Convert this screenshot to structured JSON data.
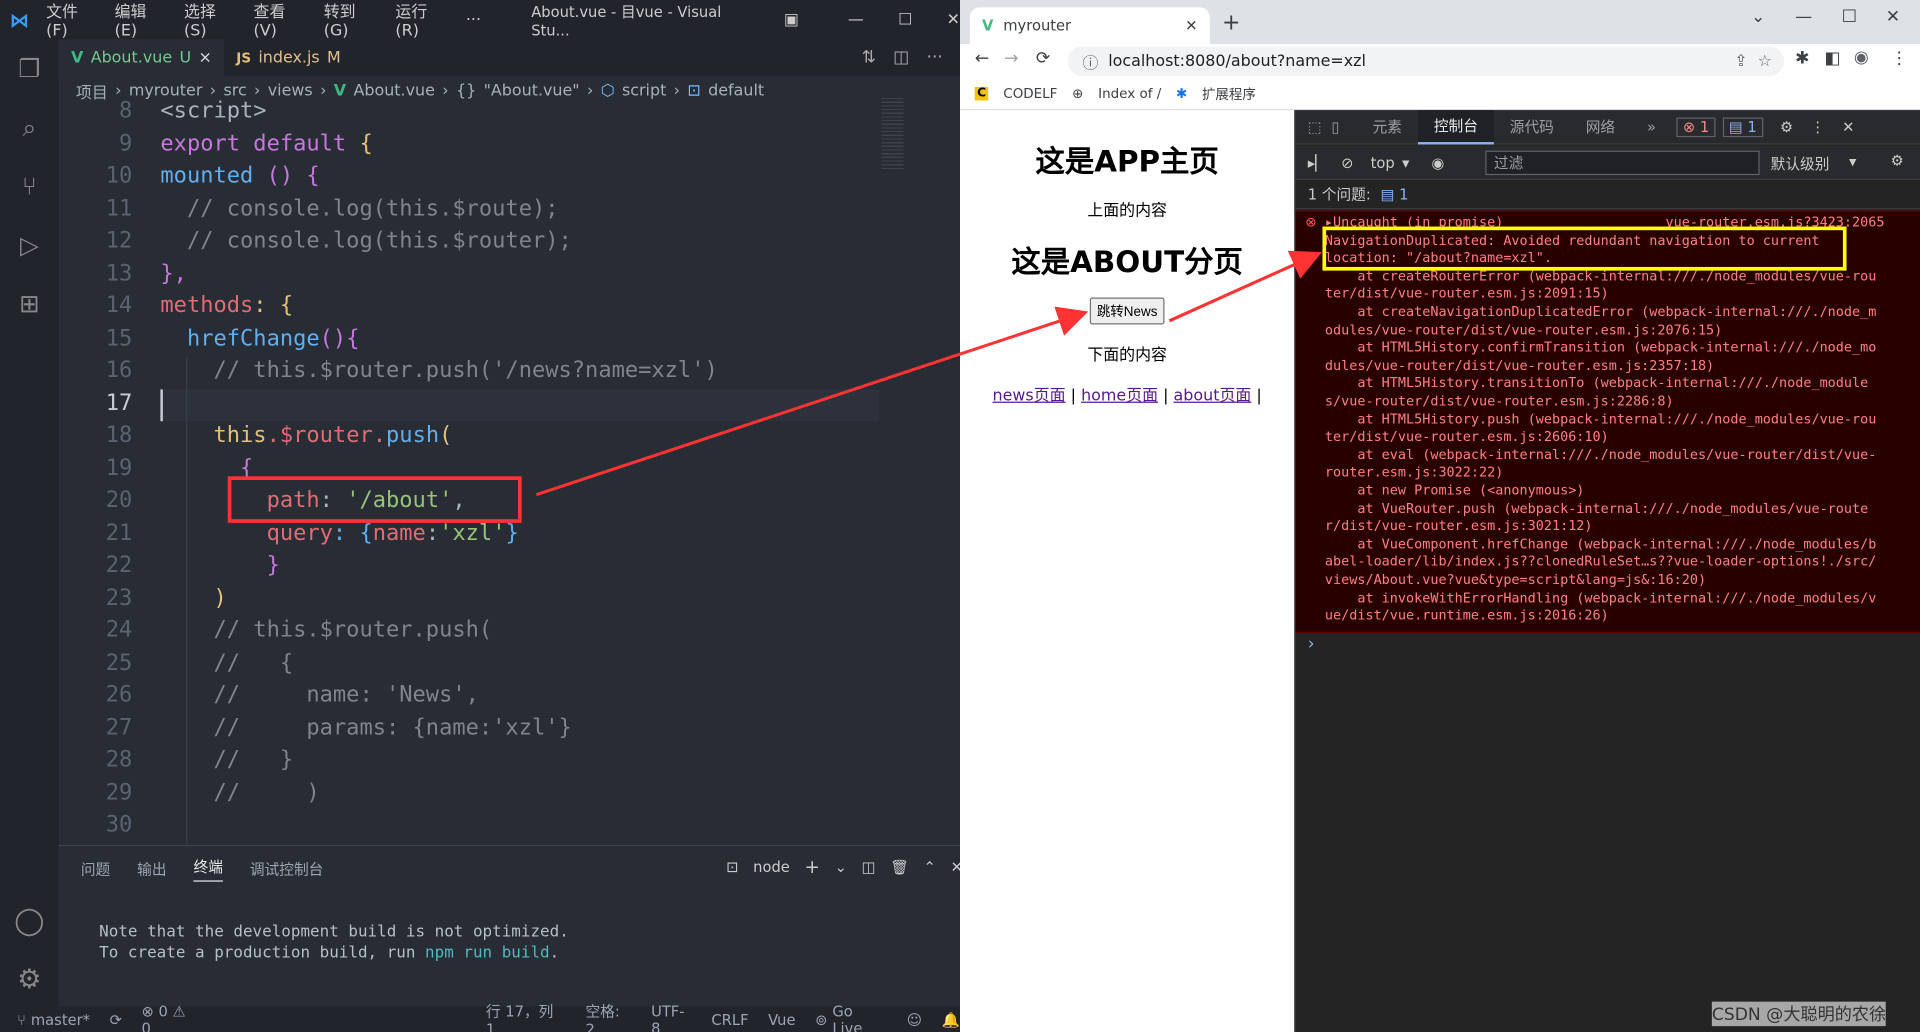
{
  "vscode": {
    "menu": [
      "文件(F)",
      "编辑(E)",
      "选择(S)",
      "查看(V)",
      "转到(G)",
      "运行(R)",
      "···"
    ],
    "window_title": "About.vue - 目vue - Visual Stu...",
    "tabs": [
      {
        "icon": "V",
        "name": "About.vue",
        "badge": "U",
        "close": "×"
      },
      {
        "icon": "JS",
        "name": "index.js",
        "badge": "M"
      }
    ],
    "breadcrumb": [
      "项目",
      "myrouter",
      "src",
      "views",
      "About.vue",
      "\"About.vue\"",
      "script",
      "default"
    ],
    "line_numbers": [
      "8",
      "9",
      "10",
      "11",
      "12",
      "13",
      "14",
      "15",
      "16",
      "17",
      "18",
      "19",
      "20",
      "21",
      "22",
      "23",
      "24",
      "25",
      "26",
      "27",
      "28",
      "29",
      "30"
    ],
    "code": {
      "l8": "<script>",
      "l9a": "export",
      "l9b": " default ",
      "l9c": "{",
      "l10a": "mounted",
      "l10b": " () {",
      "l11": "  // console.log(this.$route);",
      "l12": "  // console.log(this.$router);",
      "l13": "},",
      "l14a": "methods",
      "l14b": ": {",
      "l15a": "  hrefChange",
      "l15b": "(){",
      "l16": "    // this.$router.push('/news?name=xzl')",
      "l18a": "    this",
      "l18b": ".$router.",
      "l18c": "push",
      "l18d": "(",
      "l19": "      {",
      "l20a": "        path",
      "l20b": ": ",
      "l20c": "'/about'",
      "l20d": ",",
      "l21a": "        query",
      "l21b": ": {",
      "l21c": "name",
      "l21d": ":",
      "l21e": "'xzl'",
      "l21f": "}",
      "l22": "        }",
      "l23": "    )",
      "l24": "    // this.$router.push(",
      "l25": "    //   {",
      "l26": "    //     name: 'News',",
      "l27": "    //     params: {name:'xzl'}",
      "l28": "    //   }",
      "l29": "    //     )"
    },
    "panel_tabs": [
      "问题",
      "输出",
      "终端",
      "调试控制台"
    ],
    "terminal_name": "node",
    "terminal": {
      "line1": "Note that the development build is not optimized.",
      "line2a": "To create a production build, run ",
      "line2b": "npm run build",
      "line2c": "."
    },
    "status": {
      "branch": "master*",
      "errors": "⊗ 0 ⚠ 0",
      "position": "行 17，列 1",
      "spaces": "空格: 2",
      "encoding": "UTF-8",
      "eol": "CRLF",
      "lang": "Vue",
      "golive": "Go Live"
    }
  },
  "browser": {
    "tab_title": "myrouter",
    "url": "localhost:8080/about?name=xzl",
    "bookmarks": [
      "CODELF",
      "Index of /",
      "扩展程序"
    ],
    "page": {
      "h1": "这是APP主页",
      "above": "上面的内容",
      "h2": "这是ABOUT分页",
      "button": "跳转News",
      "below": "下面的内容",
      "links": [
        "news页面",
        "home页面",
        "about页面"
      ]
    },
    "devtools": {
      "tabs": [
        "元素",
        "控制台",
        "源代码",
        "网络",
        "»"
      ],
      "error_count": "1",
      "msg_count": "1",
      "context": "top",
      "filter_placeholder": "过滤",
      "level": "默认级别",
      "issues": "1 个问题:",
      "issues_count": "1",
      "error_lines": [
        "▸Uncaught (in promise)                    vue-router.esm.js?3423:2065",
        "NavigationDuplicated: Avoided redundant navigation to current",
        "location: \"/about?name=xzl\".",
        "    at createRouterError (webpack-internal:///./node_modules/vue-rou",
        "ter/dist/vue-router.esm.js:2091:15)",
        "    at createNavigationDuplicatedError (webpack-internal:///./node_m",
        "odules/vue-router/dist/vue-router.esm.js:2076:15)",
        "    at HTML5History.confirmTransition (webpack-internal:///./node_mo",
        "dules/vue-router/dist/vue-router.esm.js:2357:18)",
        "    at HTML5History.transitionTo (webpack-internal:///./node_module",
        "s/vue-router/dist/vue-router.esm.js:2286:8)",
        "    at HTML5History.push (webpack-internal:///./node_modules/vue-rou",
        "ter/dist/vue-router.esm.js:2606:10)",
        "    at eval (webpack-internal:///./node_modules/vue-router/dist/vue-",
        "router.esm.js:3022:22)",
        "    at new Promise (<anonymous>)",
        "    at VueRouter.push (webpack-internal:///./node_modules/vue-route",
        "r/dist/vue-router.esm.js:3021:12)",
        "    at VueComponent.hrefChange (webpack-internal:///./node_modules/b",
        "abel-loader/lib/index.js??clonedRuleSet…s??vue-loader-options!./src/",
        "views/About.vue?vue&type=script&lang=js&:16:20)",
        "    at invokeWithErrorHandling (webpack-internal:///./node_modules/v",
        "ue/dist/vue.runtime.esm.js:2016:26)"
      ],
      "prompt": "›"
    }
  },
  "watermark": "CSDN @大聪明的农徐"
}
